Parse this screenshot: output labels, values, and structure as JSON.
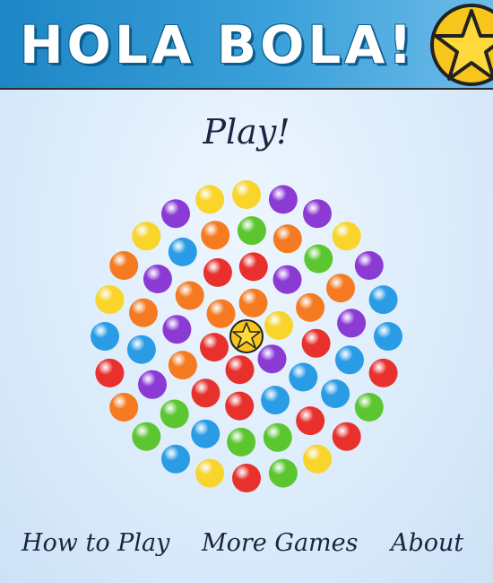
{
  "header": {
    "logo_text": "HOLA BOLA!",
    "logo_icon": "star-icon"
  },
  "main": {
    "title": "Play!"
  },
  "footer": {
    "links": [
      "How to Play",
      "More Games",
      "About"
    ]
  },
  "colors": {
    "header_start": "#1d86c5",
    "header_end": "#6cbbe8",
    "star_fill": "#f7c51b",
    "red": "#e8312d",
    "orange": "#f57a20",
    "yellow": "#f9d42b",
    "green": "#5cc631",
    "blue": "#2a9ce6",
    "purple": "#8c3ad4"
  },
  "board": {
    "center_piece": "star-icon",
    "rings": [
      [
        "orange",
        "yellow",
        "purple",
        "red",
        "red",
        "orange"
      ],
      [
        "red",
        "purple",
        "orange",
        "red",
        "blue",
        "blue",
        "red",
        "red",
        "orange",
        "purple",
        "orange",
        "red"
      ],
      [
        "green",
        "orange",
        "green",
        "orange",
        "purple",
        "blue",
        "blue",
        "red",
        "green",
        "green",
        "blue",
        "green",
        "purple",
        "blue",
        "orange",
        "purple",
        "blue",
        "orange"
      ],
      [
        "yellow",
        "purple",
        "purple",
        "yellow",
        "purple",
        "blue",
        "blue",
        "red",
        "green",
        "red",
        "yellow",
        "green",
        "red",
        "yellow",
        "blue",
        "green",
        "orange",
        "red",
        "blue",
        "yellow",
        "orange",
        "yellow",
        "purple",
        "yellow"
      ]
    ]
  }
}
